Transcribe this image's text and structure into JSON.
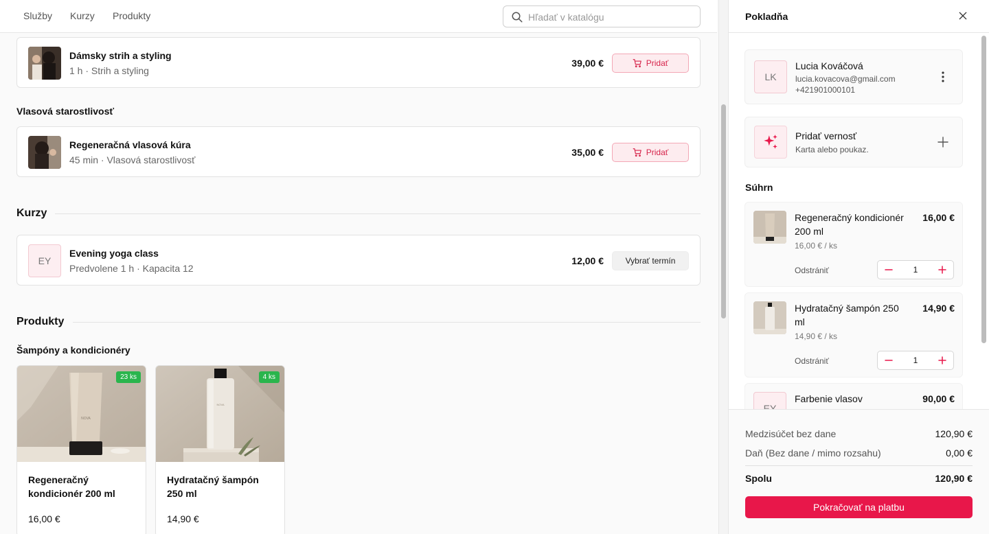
{
  "nav": {
    "tabs": [
      "Služby",
      "Kurzy",
      "Produkty"
    ],
    "search_placeholder": "Hľadať v katalógu"
  },
  "services": [
    {
      "title": "Dámsky strih a styling",
      "subtitle": "1 h · Strih a styling",
      "price": "39,00 €",
      "action": "Pridať"
    },
    {
      "title": "Regeneračná vlasová kúra",
      "subtitle": "45 min · Vlasová starostlivosť",
      "price": "35,00 €",
      "action": "Pridať"
    }
  ],
  "categories": {
    "hair_care": "Vlasová starostlivosť",
    "shampoos": "Šampóny a kondicionéry"
  },
  "sections": {
    "courses": "Kurzy",
    "products": "Produkty"
  },
  "courses": [
    {
      "initials": "EY",
      "title": "Evening yoga class",
      "subtitle": "Predvolene 1 h · Kapacita 12",
      "price": "12,00 €",
      "action": "Vybrať termín"
    }
  ],
  "products": [
    {
      "name": "Regeneračný kondicionér 200 ml",
      "price": "16,00 €",
      "stock": "23 ks",
      "brand": "NOVA"
    },
    {
      "name": "Hydratačný šampón 250 ml",
      "price": "14,90 €",
      "stock": "4 ks",
      "brand": "NOVA"
    }
  ],
  "checkout": {
    "title": "Pokladňa",
    "customer": {
      "initials": "LK",
      "name": "Lucia Kováčová",
      "email": "lucia.kovacova@gmail.com",
      "phone": "+421901000101"
    },
    "loyalty": {
      "title": "Pridať vernosť",
      "subtitle": "Karta alebo poukaz."
    },
    "summary_label": "Súhrn",
    "items": [
      {
        "name": "Regeneračný kondicionér 200 ml",
        "price": "16,00 €",
        "unit": "16,00 € / ks",
        "remove": "Odstrániť",
        "qty": "1"
      },
      {
        "name": "Hydratačný šampón 250 ml",
        "price": "14,90 €",
        "unit": "14,90 € / ks",
        "remove": "Odstrániť",
        "qty": "1"
      },
      {
        "initials": "EY",
        "name": "Farbenie vlasov",
        "price": "90,00 €"
      }
    ],
    "totals": {
      "subtotal_label": "Medzisúčet bez dane",
      "subtotal": "120,90 €",
      "tax_label": "Daň (Bez dane / mimo rozsahu)",
      "tax": "0,00 €",
      "total_label": "Spolu",
      "total": "120,90 €"
    },
    "pay_label": "Pokračovať na platbu"
  },
  "colors": {
    "accent": "#e8174a",
    "accent_soft": "#fdecef",
    "stock_badge": "#2ab54d"
  }
}
